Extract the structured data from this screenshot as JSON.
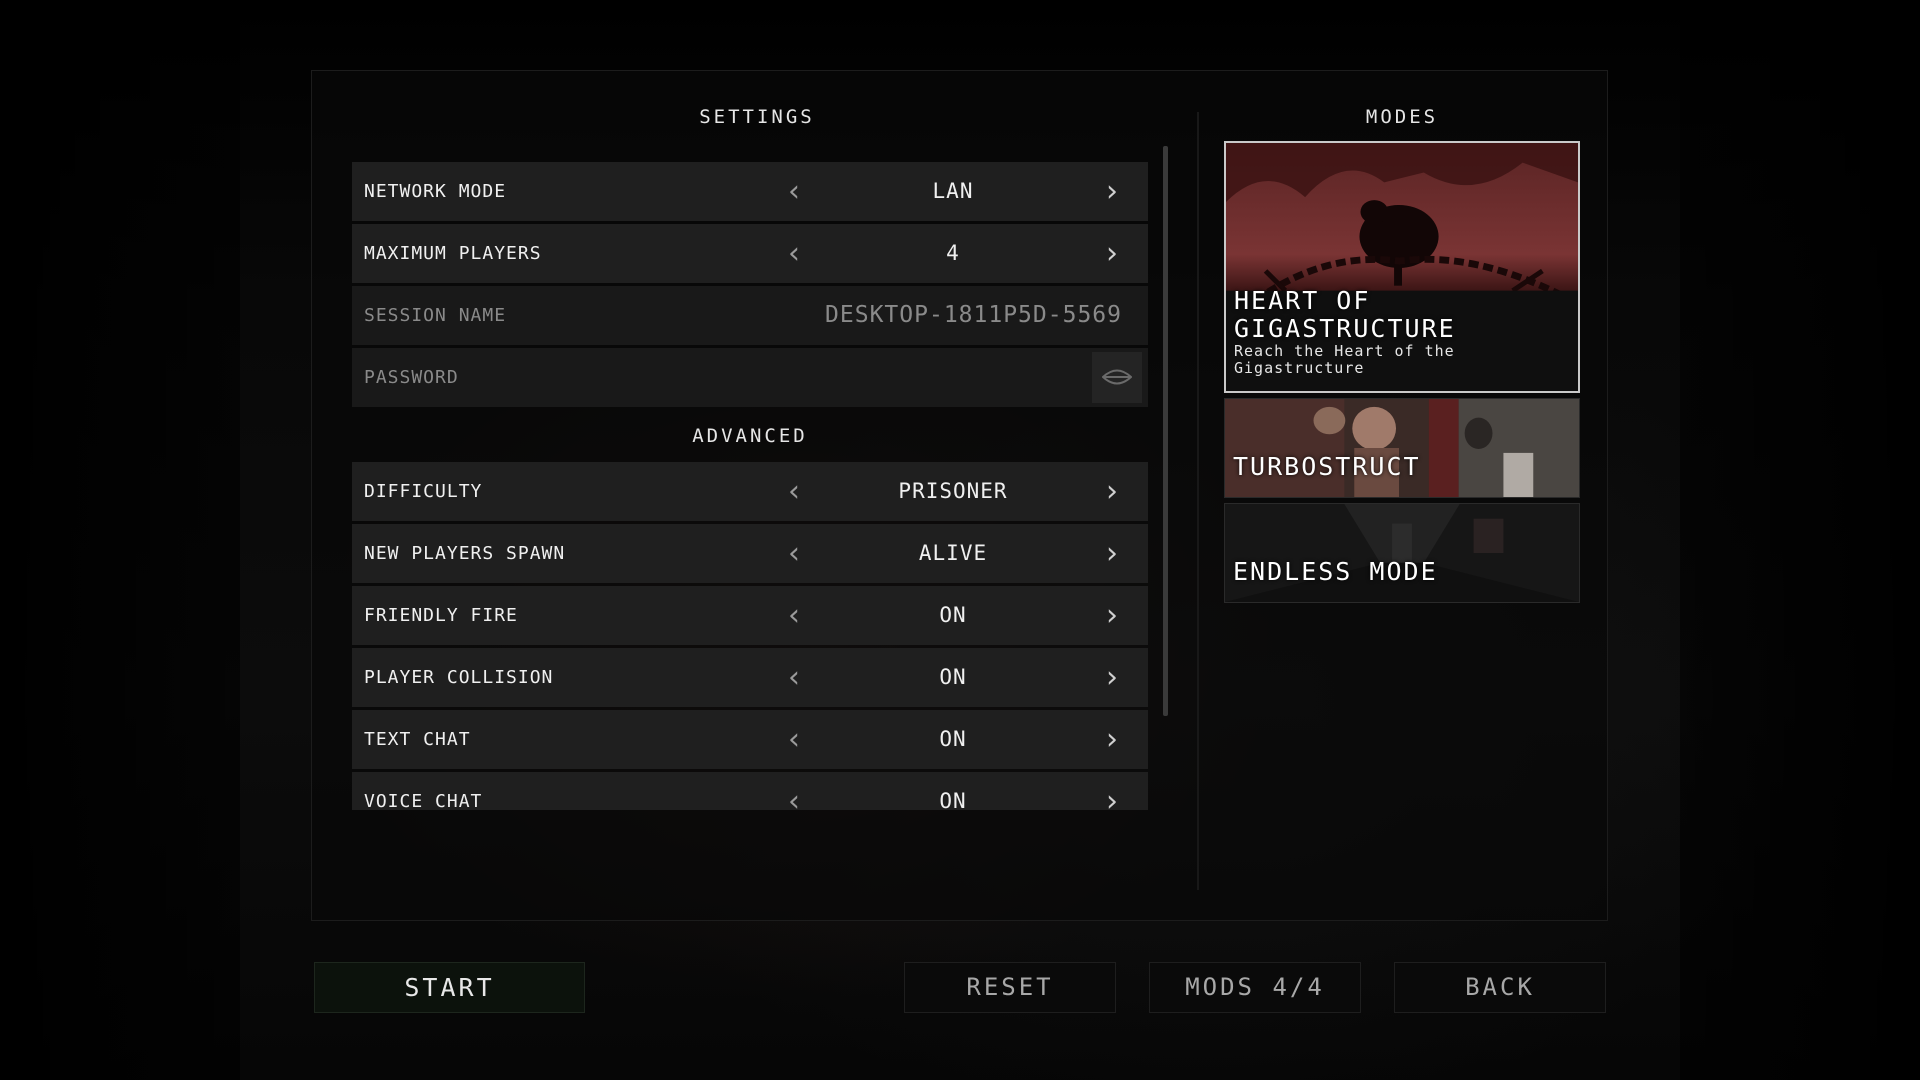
{
  "settings": {
    "title": "SETTINGS",
    "rows": [
      {
        "label": "NETWORK MODE",
        "value": "LAN"
      },
      {
        "label": "MAXIMUM PLAYERS",
        "value": "4"
      },
      {
        "label": "SESSION NAME",
        "value": "DESKTOP-1811P5D-5569"
      },
      {
        "label": "PASSWORD",
        "value": ""
      }
    ]
  },
  "advanced": {
    "title": "ADVANCED",
    "rows": [
      {
        "label": "DIFFICULTY",
        "value": "PRISONER"
      },
      {
        "label": "NEW PLAYERS SPAWN",
        "value": "ALIVE"
      },
      {
        "label": "FRIENDLY FIRE",
        "value": "ON"
      },
      {
        "label": "PLAYER COLLISION",
        "value": "ON"
      },
      {
        "label": "TEXT CHAT",
        "value": "ON"
      },
      {
        "label": "VOICE CHAT",
        "value": "ON"
      }
    ]
  },
  "modes": {
    "title": "MODES",
    "items": [
      {
        "name": "HEART OF GIGASTRUCTURE",
        "description": "Reach the Heart of the Gigastructure",
        "selected": true
      },
      {
        "name": "TURBOSTRUCT",
        "description": "",
        "selected": false
      },
      {
        "name": "ENDLESS MODE",
        "description": "",
        "selected": false
      }
    ]
  },
  "buttons": {
    "start": "START",
    "reset": "RESET",
    "mods": "MODS 4/4",
    "back": "BACK"
  },
  "icons": {
    "arrow_left": "chevron-left-icon",
    "arrow_right": "chevron-right-icon",
    "password_toggle": "eye-icon"
  },
  "colors": {
    "background": "#050505",
    "row": "#1f1f1f",
    "text": "#f0f0f0",
    "dim_text": "#8a8a8a",
    "selected_border": "#c9c9c9",
    "start_button": "#0c120c"
  }
}
